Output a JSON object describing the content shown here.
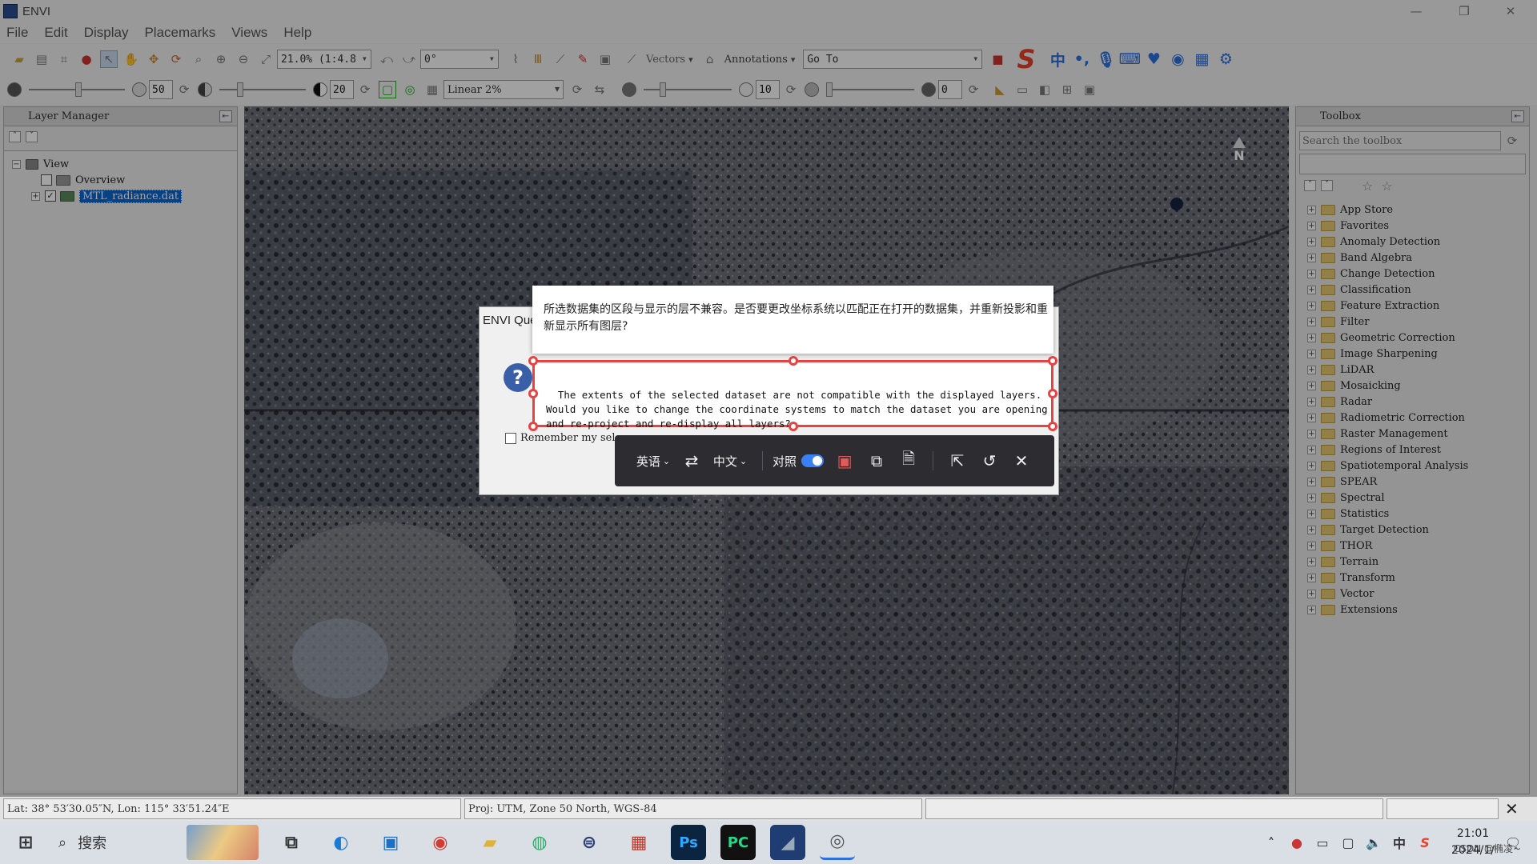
{
  "window": {
    "title": "ENVI",
    "controls": [
      "—",
      "❐",
      "✕"
    ]
  },
  "menu": [
    "File",
    "Edit",
    "Display",
    "Placemarks",
    "Views",
    "Help"
  ],
  "toolbar": {
    "zoom_value": "21.0% (1:4.8",
    "rotation_value": "0°",
    "vectors_label": "Vectors",
    "annotations_label": "Annotations",
    "goto_label": "Go To",
    "brightness_value": "50",
    "contrast_value": "20",
    "stretch_value": "Linear 2%",
    "sharpen_value": "10",
    "transparency_value": "0"
  },
  "layer_manager": {
    "title": "Layer Manager",
    "root": "View",
    "items": [
      {
        "label": "Overview",
        "checked": false,
        "selected": false
      },
      {
        "label": "MTL_radiance.dat",
        "checked": true,
        "selected": true
      }
    ]
  },
  "toolbox": {
    "title": "Toolbox",
    "search_placeholder": "Search the toolbox",
    "items": [
      "App Store",
      "Favorites",
      "Anomaly Detection",
      "Band Algebra",
      "Change Detection",
      "Classification",
      "Feature Extraction",
      "Filter",
      "Geometric Correction",
      "Image Sharpening",
      "LiDAR",
      "Mosaicking",
      "Radar",
      "Radiometric Correction",
      "Raster Management",
      "Regions of Interest",
      "Spatiotemporal Analysis",
      "SPEAR",
      "Spectral",
      "Statistics",
      "Target Detection",
      "THOR",
      "Terrain",
      "Transform",
      "Vector",
      "Extensions"
    ]
  },
  "map": {
    "north_label": "N"
  },
  "dialog": {
    "title": "ENVI Que",
    "remember_label": "Remember my sele"
  },
  "translation": {
    "translated_text": "所选数据集的区段与显示的层不兼容。是否要更改坐标系统以匹配正在打开的数据集，并重新投影和重新显示所有图层?",
    "original_text": "The extents of the selected dataset are not compatible with the displayed layers.\nWould you like to change the coordinate systems to match the dataset you are opening\nand re-project and re-display all layers?",
    "source_lang": "英语",
    "target_lang": "中文",
    "compare_label": "对照",
    "compare_on": true
  },
  "status": {
    "latlon": "Lat: 38° 53′30.05″N, Lon: 115° 33′51.24″E",
    "proj": "Proj: UTM, Zone 50 North, WGS-84"
  },
  "taskbar": {
    "search_label": "搜索",
    "time": "21:01",
    "date": "2024/1/",
    "watermark": "CSDN @椭凌~"
  },
  "colors": {
    "accent_red": "#e64343",
    "selection_blue": "#0a64d0",
    "ocr_bar": "#2d2d31",
    "toggle_blue": "#3b7ff5"
  }
}
